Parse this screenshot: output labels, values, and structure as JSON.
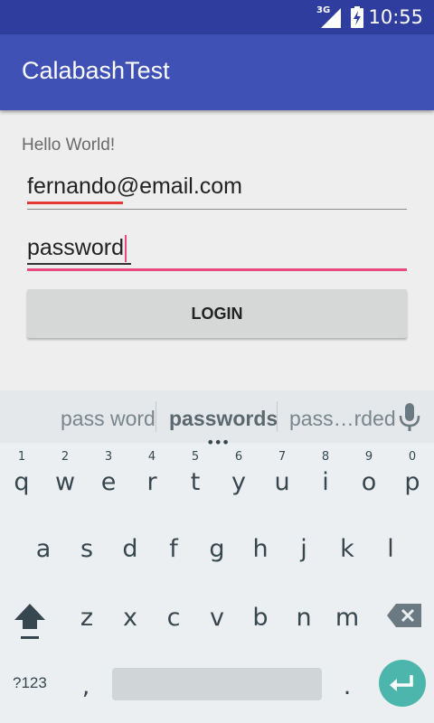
{
  "status_bar": {
    "network": "3G",
    "time": "10:55",
    "signal_icon": "signal-icon",
    "battery_icon": "battery-charging-icon"
  },
  "app_bar": {
    "title": "CalabashTest"
  },
  "content": {
    "hello_text": "Hello World!",
    "email_value": "fernando@email.com",
    "password_value": "password",
    "login_label": "LOGIN"
  },
  "keyboard": {
    "suggestions": [
      "pass word",
      "passwords",
      "pass…rded"
    ],
    "row1": [
      "q",
      "w",
      "e",
      "r",
      "t",
      "y",
      "u",
      "i",
      "o",
      "p"
    ],
    "row1_numbers": [
      "1",
      "2",
      "3",
      "4",
      "5",
      "6",
      "7",
      "8",
      "9",
      "0"
    ],
    "row2": [
      "a",
      "s",
      "d",
      "f",
      "g",
      "h",
      "j",
      "k",
      "l"
    ],
    "row3": [
      "z",
      "x",
      "c",
      "v",
      "b",
      "n",
      "m"
    ],
    "symbols_label": "?123",
    "comma": ",",
    "period": ".",
    "accent_color": "#4db6ac"
  }
}
